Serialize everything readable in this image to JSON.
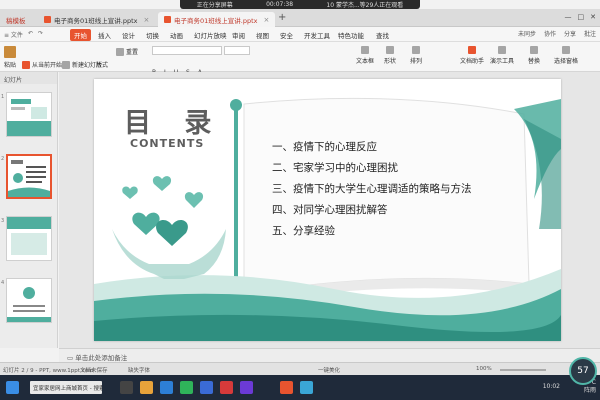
{
  "share_banner": {
    "label": "正在分享屏幕",
    "timer": "00:07:38",
    "viewers": "10 蒙学杰...等29人正在观看"
  },
  "tabs": [
    {
      "label": "稿模板"
    },
    {
      "label": "电子商务01班线上宣讲.pptx",
      "active": false
    },
    {
      "label": "电子商务01班线上宣讲.pptx",
      "active": true
    }
  ],
  "menu": {
    "left": [
      "≡ 文件",
      "↶",
      "↷"
    ],
    "items": [
      "开始",
      "插入",
      "设计",
      "切换",
      "动画",
      "幻灯片放映",
      "审阅",
      "视图",
      "安全",
      "开发工具",
      "特色功能",
      "查找"
    ],
    "active_index": 0,
    "right": [
      "未同步",
      "协作",
      "分享",
      "批注"
    ]
  },
  "toolbar": {
    "items": [
      "粘贴",
      "从当前开始",
      "新建幻灯片",
      "版式",
      "重置",
      "文本框",
      "形状",
      "排列",
      "文档助手",
      "演示工具",
      "替换",
      "选择窗格"
    ]
  },
  "left_panel": {
    "header": "幻灯片",
    "thumbs": [
      "1",
      "2",
      "3",
      "4"
    ]
  },
  "slide": {
    "title": "目 录",
    "subtitle": "CONTENTS",
    "toc": [
      "一、疫情下的心理反应",
      "二、宅家学习中的心理困扰",
      "三、疫情下的大学生心理调适的策略与方法",
      "四、对同学心理困扰解答",
      "五、分享经验"
    ],
    "colors": {
      "teal": "#4fae9e",
      "teal_dark": "#2f8f80",
      "title": "#5d5d5d"
    }
  },
  "notes": {
    "placeholder": "单击此处添加备注"
  },
  "status": {
    "left": "幻灯片 2 / 9 - PPT, www.1ppt.com",
    "backup": "文档未保存",
    "font_missing": "缺失字体",
    "beautify": "一键美化",
    "zoom": "100%"
  },
  "taskbar": {
    "search": "宜家家居网上商城首页 - 搜索一下",
    "temp": "25°C",
    "weather": "阵雨",
    "time": "10:02"
  },
  "zoom_badge": "57"
}
